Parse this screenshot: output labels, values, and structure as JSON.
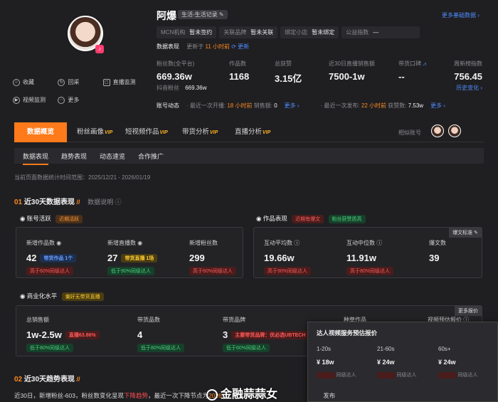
{
  "profile": {
    "name": "阿爆",
    "category": "生活-生活记录",
    "more_data": "更多基础数据 ›",
    "info": [
      {
        "k": "MCN机构",
        "v": "暂未签约"
      },
      {
        "k": "关联品牌",
        "v": "暂未关联"
      },
      {
        "k": "绑定小店",
        "v": "暂未绑定"
      },
      {
        "k": "公益指数",
        "v": "—"
      }
    ],
    "actions": [
      "收藏",
      "回采",
      "直播监测",
      "视频监测",
      "更多"
    ]
  },
  "performance": {
    "label": "数据表现",
    "updated_prefix": "更新于",
    "updated_time": "11 小时前",
    "refresh": "更新",
    "stats": [
      {
        "lbl": "粉丝数(全平台)",
        "val": "669.36w",
        "sub_k": "抖音粉丝",
        "sub_v": "669.36w"
      },
      {
        "lbl": "作品数",
        "val": "1168"
      },
      {
        "lbl": "总获赞",
        "val": "3.15亿"
      },
      {
        "lbl": "近30日直播销售额",
        "val": "7500-1w"
      },
      {
        "lbl": "带货口碑",
        "val": "--"
      },
      {
        "lbl": "周新榜指数",
        "val": "756.45",
        "sub_v": "历史变化 ›"
      }
    ]
  },
  "account": {
    "label": "账号动态",
    "live_prefix": "最近一次开播:",
    "live_time": "18 小时前",
    "live_sales_k": "销售额:",
    "live_sales_v": "0",
    "more1": "更多 ›",
    "post_prefix": "最近一次发布:",
    "post_time": "22 小时前",
    "likes_k": "获赞数:",
    "likes_v": "7.53w",
    "more2": "更多 ›"
  },
  "tabs": [
    {
      "label": "数据概览"
    },
    {
      "label": "粉丝画像",
      "vip": "VIP"
    },
    {
      "label": "短视频作品",
      "vip": "VIP"
    },
    {
      "label": "带货分析",
      "vip": "VIP"
    },
    {
      "label": "直播分析",
      "vip": "VIP"
    }
  ],
  "similar": "相似账号",
  "subtabs": [
    "数据表现",
    "趋势表现",
    "动态速览",
    "合作推广"
  ],
  "range": {
    "prefix": "当前页面数据统计时间范围：",
    "value": "2025/12/21 - 2026/01/19"
  },
  "section1": {
    "num": "01",
    "title": "近30天数据表现",
    "note": "数据说明"
  },
  "activity": {
    "title": "账号活跃",
    "badge": "近期活跃",
    "cells": [
      {
        "lbl": "新增作品数",
        "val": "42",
        "chip": "带货作品 1个",
        "cmp": "高于60%同级达人"
      },
      {
        "lbl": "新增直播数",
        "val": "27",
        "chip": "带货直播 1场",
        "cmp": "低于90%同级达人"
      },
      {
        "lbl": "新增粉丝数",
        "val": "299",
        "cmp": "高于60%同级达人"
      }
    ]
  },
  "works": {
    "title": "作品表现",
    "badge1": "近期有爆文",
    "badge2": "粉丝获赞质高",
    "corner": "爆文标准",
    "cells": [
      {
        "lbl": "互动平均数",
        "val": "19.66w",
        "cmp": "高于90%同级达人"
      },
      {
        "lbl": "互动中位数",
        "val": "11.91w",
        "cmp": "高于80%同级达人"
      },
      {
        "lbl": "爆文数",
        "val": "39"
      }
    ]
  },
  "commerce": {
    "title": "商业化水平",
    "badge": "偏好无带货直播",
    "corner": "更多报价",
    "cells": [
      {
        "lbl": "总销售额",
        "val": "1w-2.5w",
        "chip": "直播63.86%",
        "cmp": "低于80%同级达人"
      },
      {
        "lbl": "带货品数",
        "val": "4",
        "cmp": "低于80%同级达人"
      },
      {
        "lbl": "带货品牌",
        "val": "3",
        "chip": "主要带货品牌：优必选UBTECH",
        "cmp": "低于60%同级达人"
      },
      {
        "lbl": "种草作品"
      },
      {
        "lbl": "视频预估报价"
      }
    ]
  },
  "popup": {
    "title": "达人视频服务预估报价",
    "cols": [
      {
        "dur": "1-20s",
        "price": "¥ 18w",
        "cmp": "同级达人"
      },
      {
        "dur": "21-60s",
        "price": "¥ 24w",
        "cmp": "同级达人"
      },
      {
        "dur": "60s+",
        "price": "¥ 24w",
        "cmp": "同级达人"
      }
    ]
  },
  "section2": {
    "num": "02",
    "title": "近30天趋势表现"
  },
  "trend_text": {
    "a": "近30日，新增粉丝-603，粉丝数变化呈现",
    "b": "下降趋势",
    "c": "，最近一次下降节点为",
    "d": "2026",
    "e": "发布"
  },
  "watermark": "金融蒜蒜女",
  "colors": {
    "accent": "#ff7a1a",
    "link": "#4f8cff",
    "bg": "#1f1f22"
  }
}
